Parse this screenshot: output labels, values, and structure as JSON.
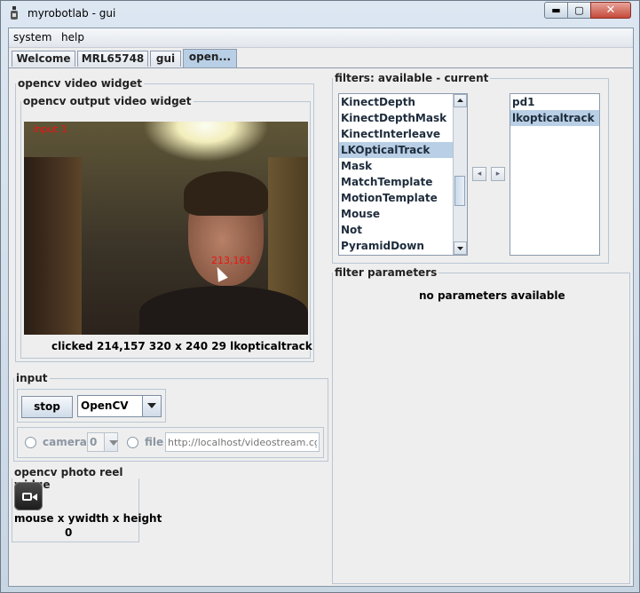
{
  "window": {
    "title": "myrobotlab - gui",
    "min_label": "▬",
    "max_label": "▢",
    "close_label": "✕"
  },
  "menu": [
    "system",
    "help"
  ],
  "tabs": [
    "Welcome",
    "MRL65748",
    "gui",
    "open..."
  ],
  "video_widget": {
    "legend": "opencv  video widget",
    "output_legend": "opencv  output video widget",
    "overlay_top_left": "input 1",
    "overlay_point": "213,161",
    "status": "clicked 214,157   320 x 240  29  lkopticaltrack"
  },
  "input": {
    "legend": "input",
    "stop_label": "stop",
    "source_value": "OpenCV",
    "camera_label": "camera",
    "camera_index": "0",
    "file_label": "file",
    "file_placeholder": "http://localhost/videostream.cgi"
  },
  "photo_reel": {
    "legend": "opencv  photo reel widge",
    "caption": "mouse x ywidth x height",
    "count": "0"
  },
  "filters": {
    "legend": "filters: available - current",
    "available": [
      "KinectDepth",
      "KinectDepthMask",
      "KinectInterleave",
      "LKOpticalTrack",
      "Mask",
      "MatchTemplate",
      "MotionTemplate",
      "Mouse",
      "Not",
      "PyramidDown"
    ],
    "available_selected_index": 3,
    "current": [
      "pd1",
      "lkopticaltrack"
    ],
    "current_selected_index": 1,
    "move_left_label": "◂",
    "move_right_label": "▸"
  },
  "filter_parameters": {
    "legend": "filter parameters",
    "message": "no parameters available"
  },
  "colors": {
    "selection": "#b8cfe5",
    "overlay_text": "#e11111"
  }
}
